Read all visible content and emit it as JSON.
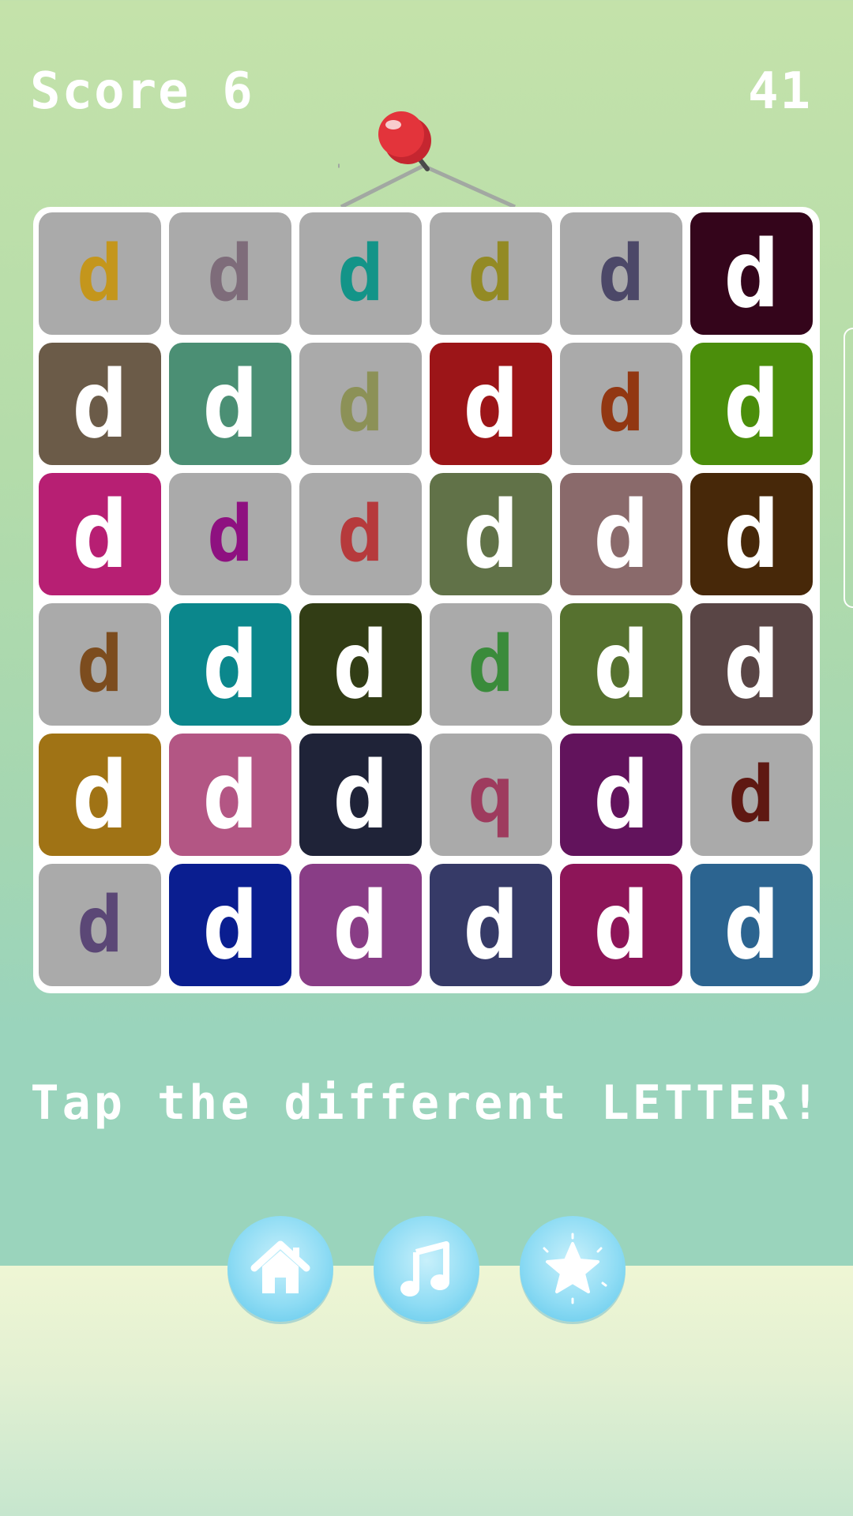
{
  "hud": {
    "score_text": "Score 6",
    "timer_text": "41"
  },
  "instruction": "Tap the different LETTER!",
  "board": {
    "rows": 6,
    "cols": 6,
    "tiles": [
      {
        "letter": "d",
        "bg": "#aaaaaa",
        "fg": "#c4961c"
      },
      {
        "letter": "d",
        "bg": "#aaaaaa",
        "fg": "#7e6c7a"
      },
      {
        "letter": "d",
        "bg": "#aaaaaa",
        "fg": "#139488"
      },
      {
        "letter": "d",
        "bg": "#aaaaaa",
        "fg": "#938a24"
      },
      {
        "letter": "d",
        "bg": "#aaaaaa",
        "fg": "#4c4868"
      },
      {
        "letter": "d",
        "bg": "#34051b",
        "fg": "#ffffff"
      },
      {
        "letter": "d",
        "bg": "#6b5b48",
        "fg": "#ffffff"
      },
      {
        "letter": "d",
        "bg": "#4b8f74",
        "fg": "#ffffff"
      },
      {
        "letter": "d",
        "bg": "#aaaaaa",
        "fg": "#8c9157"
      },
      {
        "letter": "d",
        "bg": "#9c1518",
        "fg": "#ffffff"
      },
      {
        "letter": "d",
        "bg": "#aaaaaa",
        "fg": "#923712"
      },
      {
        "letter": "d",
        "bg": "#4b8e0b",
        "fg": "#ffffff"
      },
      {
        "letter": "d",
        "bg": "#b71f73",
        "fg": "#ffffff"
      },
      {
        "letter": "d",
        "bg": "#aaaaaa",
        "fg": "#8e1180"
      },
      {
        "letter": "d",
        "bg": "#aaaaaa",
        "fg": "#b63a3c"
      },
      {
        "letter": "d",
        "bg": "#617248",
        "fg": "#ffffff"
      },
      {
        "letter": "d",
        "bg": "#8a6a6b",
        "fg": "#ffffff"
      },
      {
        "letter": "d",
        "bg": "#472809",
        "fg": "#ffffff"
      },
      {
        "letter": "d",
        "bg": "#aaaaaa",
        "fg": "#7c4c1e"
      },
      {
        "letter": "d",
        "bg": "#0b878c",
        "fg": "#ffffff"
      },
      {
        "letter": "d",
        "bg": "#323d15",
        "fg": "#ffffff"
      },
      {
        "letter": "d",
        "bg": "#aaaaaa",
        "fg": "#3a8b3b"
      },
      {
        "letter": "d",
        "bg": "#56712f",
        "fg": "#ffffff"
      },
      {
        "letter": "d",
        "bg": "#594545",
        "fg": "#ffffff"
      },
      {
        "letter": "d",
        "bg": "#a07315",
        "fg": "#ffffff"
      },
      {
        "letter": "d",
        "bg": "#b35684",
        "fg": "#ffffff"
      },
      {
        "letter": "d",
        "bg": "#1f2338",
        "fg": "#ffffff"
      },
      {
        "letter": "q",
        "bg": "#aaaaaa",
        "fg": "#9e3b5e"
      },
      {
        "letter": "d",
        "bg": "#62135c",
        "fg": "#ffffff"
      },
      {
        "letter": "d",
        "bg": "#aaaaaa",
        "fg": "#5f1812"
      },
      {
        "letter": "d",
        "bg": "#aaaaaa",
        "fg": "#5b4776"
      },
      {
        "letter": "d",
        "bg": "#0a1e90",
        "fg": "#ffffff"
      },
      {
        "letter": "d",
        "bg": "#893d86",
        "fg": "#ffffff"
      },
      {
        "letter": "d",
        "bg": "#363a67",
        "fg": "#ffffff"
      },
      {
        "letter": "d",
        "bg": "#8d1558",
        "fg": "#ffffff"
      },
      {
        "letter": "d",
        "bg": "#2c6490",
        "fg": "#ffffff"
      }
    ]
  },
  "buttons": [
    {
      "name": "home-button",
      "icon": "home-icon"
    },
    {
      "name": "music-button",
      "icon": "music-note-icon"
    },
    {
      "name": "rate-button",
      "icon": "star-icon"
    }
  ],
  "colors": {
    "board_bg": "#ffffff",
    "neutral_tile": "#aaaaaa",
    "pin_red": "#e3343b",
    "button_blue": "#8fdcf4"
  }
}
